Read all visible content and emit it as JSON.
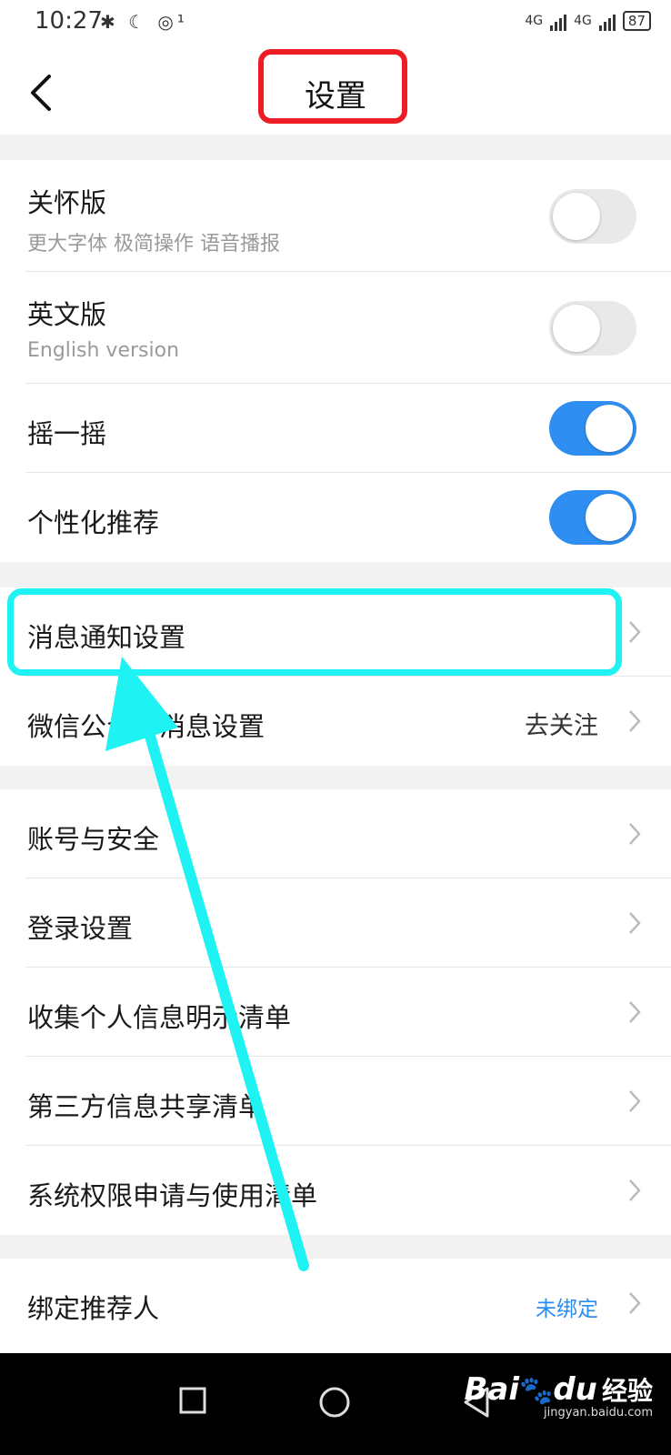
{
  "status": {
    "time": "10:27",
    "left_icons": "✱ ☾ ◎¹",
    "net1": "4G",
    "net2": "4G",
    "battery": "87"
  },
  "header": {
    "title": "设置"
  },
  "groups": [
    {
      "items": [
        {
          "title": "关怀版",
          "subtitle": "更大字体 极简操作 语音播报",
          "toggle": false
        },
        {
          "title": "英文版",
          "subtitle": "English version",
          "toggle": false
        },
        {
          "title": "摇一摇",
          "toggle": true
        },
        {
          "title": "个性化推荐",
          "toggle": true
        }
      ]
    },
    {
      "items": [
        {
          "title": "消息通知设置"
        },
        {
          "title": "微信公众号消息设置",
          "value": "去关注"
        }
      ]
    },
    {
      "items": [
        {
          "title": "账号与安全"
        },
        {
          "title": "登录设置"
        },
        {
          "title": "收集个人信息明示清单"
        },
        {
          "title": "第三方信息共享清单"
        },
        {
          "title": "系统权限申请与使用清单"
        }
      ]
    },
    {
      "items": [
        {
          "title": "绑定推荐人",
          "value": "未绑定"
        }
      ]
    }
  ],
  "watermark": {
    "brand": "Bai",
    "brand2": "du",
    "cn": "经验",
    "url": "jingyan.baidu.com"
  },
  "colors": {
    "toggle_on": "#2e8ef2",
    "highlight_red": "#ee1c24",
    "highlight_cyan": "#1ff2f2",
    "link_blue": "#2a8df0"
  }
}
